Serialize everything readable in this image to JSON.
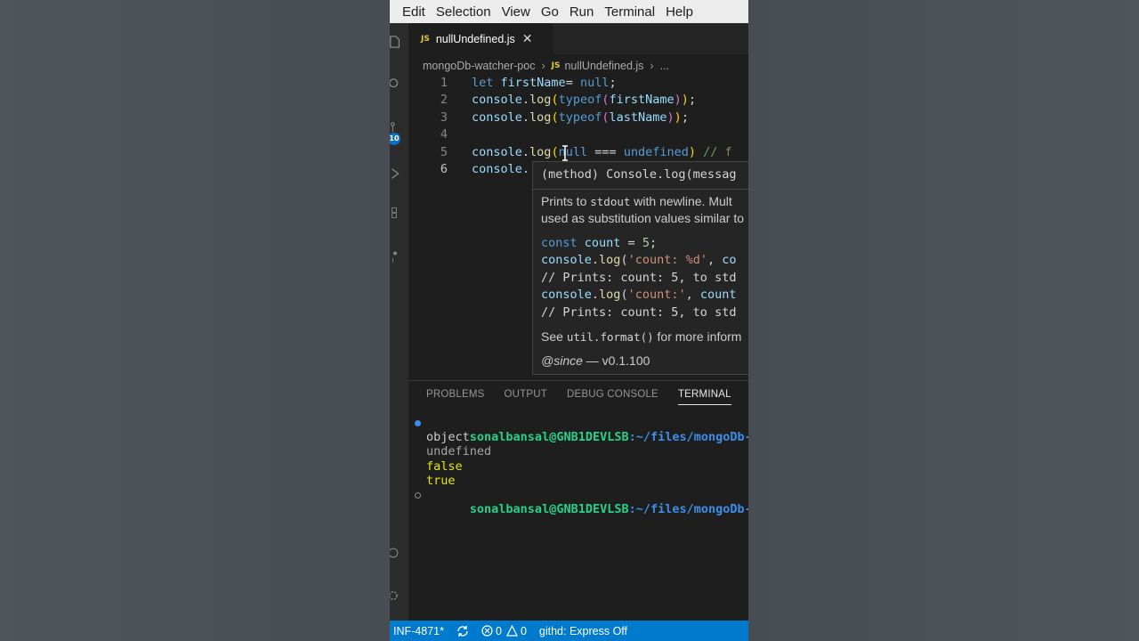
{
  "menu": [
    "Edit",
    "Selection",
    "View",
    "Go",
    "Run",
    "Terminal",
    "Help"
  ],
  "activity": {
    "badge": "10"
  },
  "tab": {
    "icon": "JS",
    "name": "nullUndefined.js",
    "close": "✕"
  },
  "breadcrumb": {
    "folder": "mongoDb-watcher-poc",
    "file_icon": "JS",
    "file": "nullUndefined.js",
    "more": "..."
  },
  "editor": {
    "line_numbers": [
      "1",
      "2",
      "3",
      "4",
      "5",
      "6"
    ],
    "lines": [
      "let firstName= null;",
      "console.log(typeof(firstName));",
      "console.log(typeof(lastName));",
      "",
      "console.log(null === undefined) // f",
      "console.log(null == undefined)"
    ],
    "visible_line6": "console."
  },
  "hover": {
    "signature": "(method) Console.log(messag",
    "desc_line1_pre": "Prints to ",
    "desc_line1_code": "stdout",
    "desc_line1_post": " with newline. Mult",
    "desc_line2": "used as substitution values similar to",
    "code": [
      "const count = 5;",
      "console.log('count: %d', co",
      "// Prints: count: 5, to std",
      "console.log('count:', count",
      "// Prints: count: 5, to std"
    ],
    "see_pre": "See ",
    "see_code": "util.format()",
    "see_post": " for more inform",
    "since_tag": "@since",
    "since_value": " — v0.1.100"
  },
  "panel": {
    "tabs": [
      "PROBLEMS",
      "OUTPUT",
      "DEBUG CONSOLE",
      "TERMINAL"
    ],
    "active_tab": "TERMINAL"
  },
  "terminal": {
    "prompt_user": "sonalbansal@GNB1DEVLSB",
    "prompt_path": ":~/files/mongoDb-watche",
    "output": [
      "object",
      "undefined",
      "false",
      "true"
    ]
  },
  "status": {
    "branch": "INF-4871*",
    "errors": "0",
    "warnings": "0",
    "extension": "githd: Express Off"
  },
  "colors": {
    "accent": "#007acc",
    "editor_bg": "#1e1e1e",
    "prompt_user": "#23d18b",
    "prompt_path": "#3b8eea"
  }
}
